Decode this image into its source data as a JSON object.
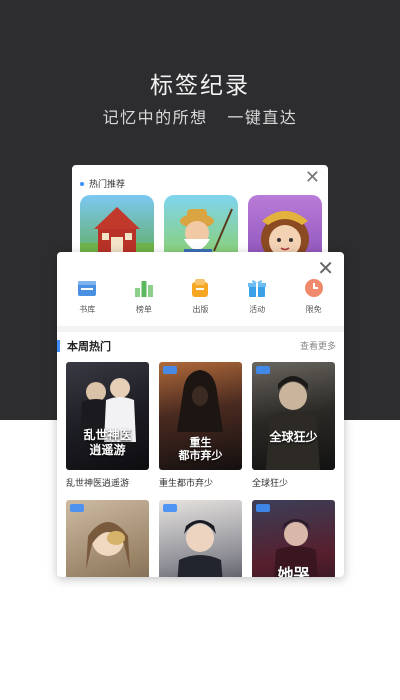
{
  "header": {
    "title": "标签纪录",
    "subtitle": "记忆中的所想   一键直达"
  },
  "back_card": {
    "section_title": "热门推荐",
    "close_icon": "close-icon",
    "apps": [
      {
        "icon": "farm-barn-game-icon"
      },
      {
        "icon": "fishing-grandpa-game-icon"
      },
      {
        "icon": "girl-character-game-icon"
      }
    ]
  },
  "front_card": {
    "close_icon": "close-icon",
    "categories": [
      {
        "label": "书库",
        "icon": "library-icon",
        "color": "#4a90e2"
      },
      {
        "label": "榜单",
        "icon": "ranking-icon",
        "color": "#5cb85c"
      },
      {
        "label": "出版",
        "icon": "publish-icon",
        "color": "#f5a623"
      },
      {
        "label": "活动",
        "icon": "gift-icon",
        "color": "#3aa0e8"
      },
      {
        "label": "限免",
        "icon": "clock-icon",
        "color": "#f08a6c"
      }
    ],
    "section": {
      "title": "本周热门",
      "more": "查看更多"
    },
    "books": [
      {
        "title": "乱世神医逍遥游",
        "cover_text": "乱世神医\n逍遥游"
      },
      {
        "title": "重生都市弃少",
        "cover_text": "重生\n都市弃少"
      },
      {
        "title": "全球狂少",
        "cover_text": "全球狂少"
      },
      {
        "title": "",
        "cover_text": ""
      },
      {
        "title": "",
        "cover_text": ""
      },
      {
        "title": "",
        "cover_text": "她哭"
      }
    ]
  },
  "colors": {
    "hero_bg": "#2d2d2f",
    "accent": "#3f8ef7"
  }
}
